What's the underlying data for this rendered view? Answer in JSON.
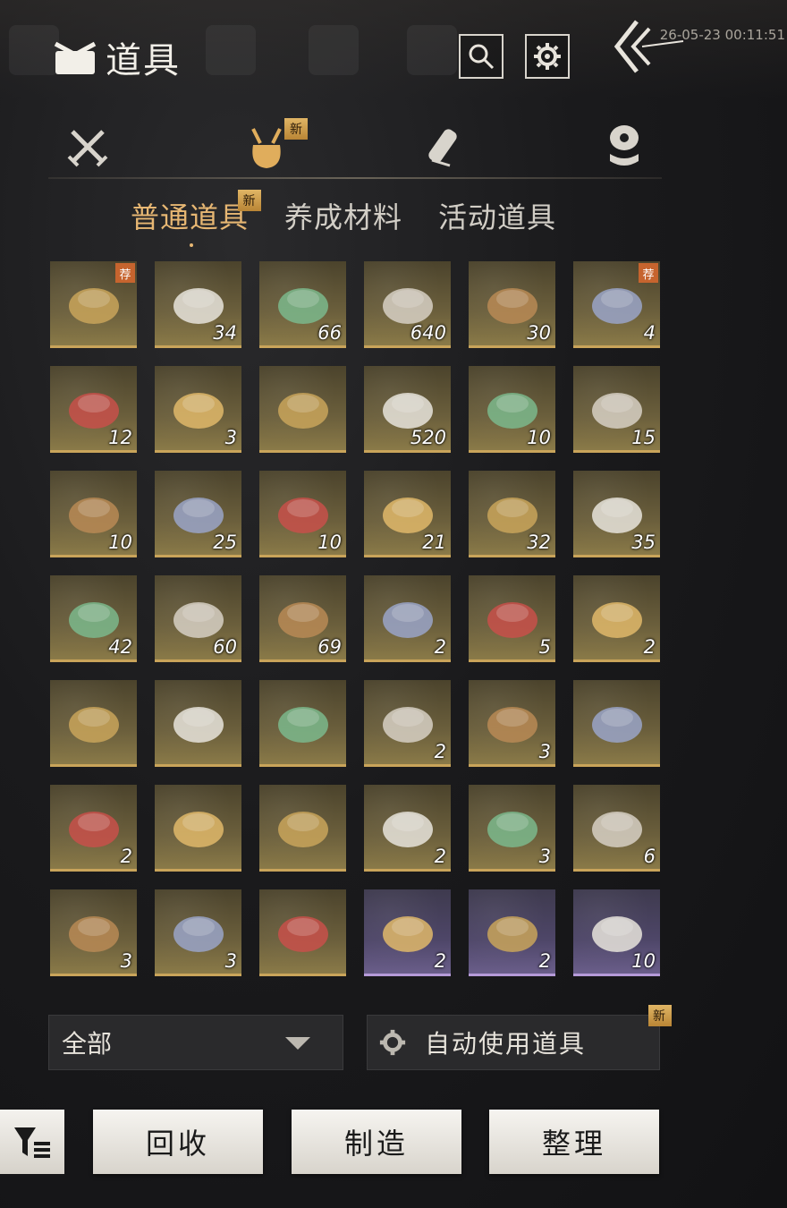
{
  "header": {
    "title": "道具",
    "timestamp": "26-05-23 00:11:51",
    "search_icon": "search-icon",
    "settings_icon": "gear-icon",
    "back_icon": "double-chevron-left-icon"
  },
  "categories": [
    {
      "icon": "crossed-swords-icon",
      "active": false,
      "new": false
    },
    {
      "icon": "pouch-icon",
      "active": true,
      "new": true
    },
    {
      "icon": "scroll-icon",
      "active": false,
      "new": false
    },
    {
      "icon": "coin-stack-icon",
      "active": false,
      "new": false
    }
  ],
  "new_badge": "新",
  "subtabs": [
    {
      "label": "普通道具",
      "active": true,
      "new": true
    },
    {
      "label": "养成材料",
      "active": false,
      "new": false
    },
    {
      "label": "活动道具",
      "active": false,
      "new": false
    }
  ],
  "rec_badge": "荐",
  "items": [
    {
      "name": "gift-chest-heart",
      "qty": "",
      "rec": true,
      "rarity": "gold"
    },
    {
      "name": "chest-snail-shell",
      "qty": "34",
      "rec": false,
      "rarity": "gold"
    },
    {
      "name": "chest-herb",
      "qty": "66",
      "rec": false,
      "rarity": "gold"
    },
    {
      "name": "chest-ore",
      "qty": "640",
      "rec": false,
      "rarity": "gold"
    },
    {
      "name": "chest-robe",
      "qty": "30",
      "rec": false,
      "rarity": "gold"
    },
    {
      "name": "gift-chest-heart",
      "qty": "4",
      "rec": true,
      "rarity": "gold"
    },
    {
      "name": "spirit-wisp",
      "qty": "12",
      "rec": false,
      "rarity": "gold"
    },
    {
      "name": "spirit-wisp-blue",
      "qty": "3",
      "rec": false,
      "rarity": "gold"
    },
    {
      "name": "book",
      "qty": "",
      "rec": false,
      "rarity": "gold"
    },
    {
      "name": "jade-disc",
      "qty": "520",
      "rec": false,
      "rarity": "gold"
    },
    {
      "name": "fish-token",
      "qty": "10",
      "rec": false,
      "rarity": "gold"
    },
    {
      "name": "bronze-bell",
      "qty": "15",
      "rec": false,
      "rarity": "gold"
    },
    {
      "name": "gold-ingot",
      "qty": "10",
      "rec": false,
      "rarity": "gold"
    },
    {
      "name": "cat-coin",
      "qty": "25",
      "rec": false,
      "rarity": "gold"
    },
    {
      "name": "porcelain-bowl-pink",
      "qty": "10",
      "rec": false,
      "rarity": "gold"
    },
    {
      "name": "porcelain-bowl-floral",
      "qty": "21",
      "rec": false,
      "rarity": "gold"
    },
    {
      "name": "rooster-bowl",
      "qty": "32",
      "rec": false,
      "rarity": "gold"
    },
    {
      "name": "white-bowl",
      "qty": "35",
      "rec": false,
      "rarity": "gold"
    },
    {
      "name": "lidded-cup",
      "qty": "42",
      "rec": false,
      "rarity": "gold"
    },
    {
      "name": "plate",
      "qty": "60",
      "rec": false,
      "rarity": "gold"
    },
    {
      "name": "blue-rim-bowl",
      "qty": "69",
      "rec": false,
      "rarity": "gold"
    },
    {
      "name": "golden-bee",
      "qty": "2",
      "rec": false,
      "rarity": "gold"
    },
    {
      "name": "red-goldfish",
      "qty": "5",
      "rec": false,
      "rarity": "gold"
    },
    {
      "name": "orange-fish",
      "qty": "2",
      "rec": false,
      "rarity": "gold"
    },
    {
      "name": "striped-beetle",
      "qty": "",
      "rec": false,
      "rarity": "gold"
    },
    {
      "name": "yellow-bird",
      "qty": "",
      "rec": false,
      "rarity": "gold"
    },
    {
      "name": "green-katydid",
      "qty": "",
      "rec": false,
      "rarity": "gold"
    },
    {
      "name": "fossil-stone",
      "qty": "2",
      "rec": false,
      "rarity": "gold"
    },
    {
      "name": "fossil-stone-blue",
      "qty": "3",
      "rec": false,
      "rarity": "gold"
    },
    {
      "name": "fossil-stone-grey",
      "qty": "",
      "rec": false,
      "rarity": "gold"
    },
    {
      "name": "blue-flowers",
      "qty": "2",
      "rec": false,
      "rarity": "gold"
    },
    {
      "name": "branch",
      "qty": "",
      "rec": false,
      "rarity": "gold"
    },
    {
      "name": "golden-toad",
      "qty": "",
      "rec": false,
      "rarity": "gold"
    },
    {
      "name": "silver-flower",
      "qty": "2",
      "rec": false,
      "rarity": "gold"
    },
    {
      "name": "pinecone-egg",
      "qty": "3",
      "rec": false,
      "rarity": "gold"
    },
    {
      "name": "cricket",
      "qty": "6",
      "rec": false,
      "rarity": "gold"
    },
    {
      "name": "fireflies",
      "qty": "3",
      "rec": false,
      "rarity": "gold"
    },
    {
      "name": "dragonfly",
      "qty": "3",
      "rec": false,
      "rarity": "gold"
    },
    {
      "name": "purple-flowers",
      "qty": "",
      "rec": false,
      "rarity": "gold"
    },
    {
      "name": "silk-pouch",
      "qty": "2",
      "rec": false,
      "rarity": "purple"
    },
    {
      "name": "lacquer-box",
      "qty": "2",
      "rec": false,
      "rarity": "purple"
    },
    {
      "name": "wooden-cabinet",
      "qty": "10",
      "rec": false,
      "rarity": "purple"
    }
  ],
  "controls": {
    "filter_dropdown": "全部",
    "auto_use_label": "自动使用道具",
    "auto_use_new": true
  },
  "actions": {
    "recycle": "回收",
    "craft": "制造",
    "sort": "整理"
  },
  "colors": {
    "accent": "#e7b773",
    "badge": "#c9943f",
    "rec_badge": "#c6642e"
  }
}
